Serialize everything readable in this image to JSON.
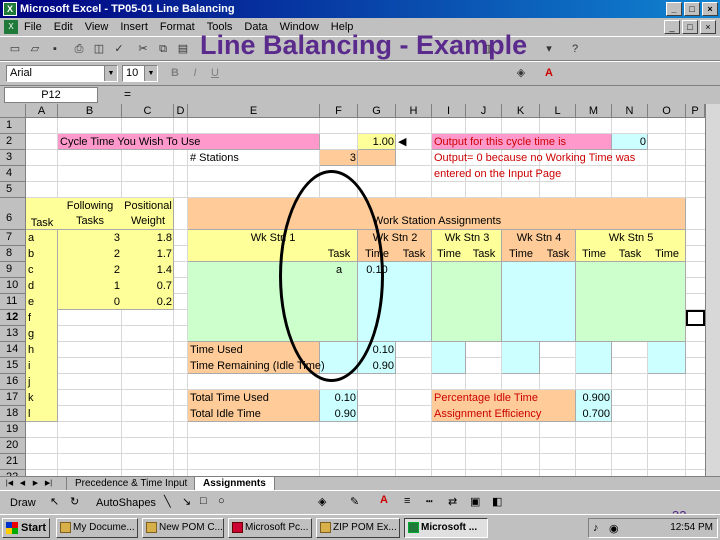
{
  "window": {
    "title": "Microsoft Excel - TP05-01 Line Balancing",
    "minimize": "_",
    "restore": "□",
    "close": "×"
  },
  "menu": [
    "File",
    "Edit",
    "View",
    "Insert",
    "Format",
    "Tools",
    "Data",
    "Window",
    "Help"
  ],
  "slide": {
    "title": "Line Balancing - Example",
    "page_number": "32"
  },
  "font": {
    "name": "Arial",
    "size": "10"
  },
  "name_box": "P12",
  "formula_eq": "=",
  "columns": [
    "A",
    "B",
    "C",
    "D",
    "E",
    "F",
    "G",
    "H",
    "I",
    "J",
    "K",
    "L",
    "M",
    "N",
    "O",
    "P"
  ],
  "rows": [
    "1",
    "2",
    "3",
    "4",
    "5",
    "6",
    "7",
    "8",
    "9",
    "10",
    "11",
    "12",
    "13",
    "14",
    "15",
    "16",
    "17",
    "18",
    "19",
    "20",
    "21",
    "22"
  ],
  "sheet": {
    "cycle_label": "Cycle Time You Wish To Use",
    "cycle_value": "1.00",
    "stations_label": "# Stations",
    "stations_value": "3",
    "output_label": "Output for this cycle time is",
    "output_value": "0",
    "note_line1": "Output= 0 because no Working Time was",
    "note_line2": "entered on the Input Page",
    "task_hdr": "Task",
    "following_hdr1": "Following",
    "following_hdr2": "Tasks",
    "positional_hdr1": "Positional",
    "positional_hdr2": "Weight",
    "tasks": [
      "a",
      "b",
      "c",
      "d",
      "e",
      "f",
      "g",
      "h",
      "i",
      "j",
      "k",
      "l"
    ],
    "following": [
      "3",
      "2",
      "2",
      "1",
      "0"
    ],
    "weights": [
      "1.8",
      "1.7",
      "1.4",
      "0.7",
      "0.2"
    ],
    "wsa_title": "Work Station Assignments",
    "stations": [
      "Wk Stn 1",
      "Wk Stn 2",
      "Wk Stn 3",
      "Wk Stn 4",
      "Wk Stn 5"
    ],
    "task_col": "Task",
    "time_col": "Time",
    "stn1_task": "a",
    "stn1_time": "0.10",
    "time_used_label": "Time Used",
    "time_used_value": "0.10",
    "time_remaining_label": "Time Remaining (Idle Time)",
    "time_remaining_value": "0.90",
    "total_time_used_label": "Total Time Used",
    "total_time_used_value": "0.10",
    "total_idle_label": "Total Idle Time",
    "total_idle_value": "0.90",
    "pct_idle_label": "Percentage Idle Time",
    "pct_idle_value": "0.900",
    "efficiency_label": "Assignment Efficiency",
    "efficiency_value": "0.700"
  },
  "tabs": [
    "Precedence & Time Input",
    "Assignments"
  ],
  "draw_toolbar": {
    "draw": "Draw",
    "autoshapes": "AutoShapes"
  },
  "taskbar": {
    "start": "Start",
    "items": [
      "My Docume...",
      "New POM C...",
      "Microsoft Pc...",
      "ZIP POM Ex...",
      "Microsoft ..."
    ],
    "clock": "12:54 PM"
  },
  "colors": {
    "pink": "#ff99cc",
    "peach": "#ffcc99",
    "yellow": "#ffff99",
    "green": "#ccffcc",
    "cyan": "#ccffff",
    "red_text": "#cc0000"
  }
}
